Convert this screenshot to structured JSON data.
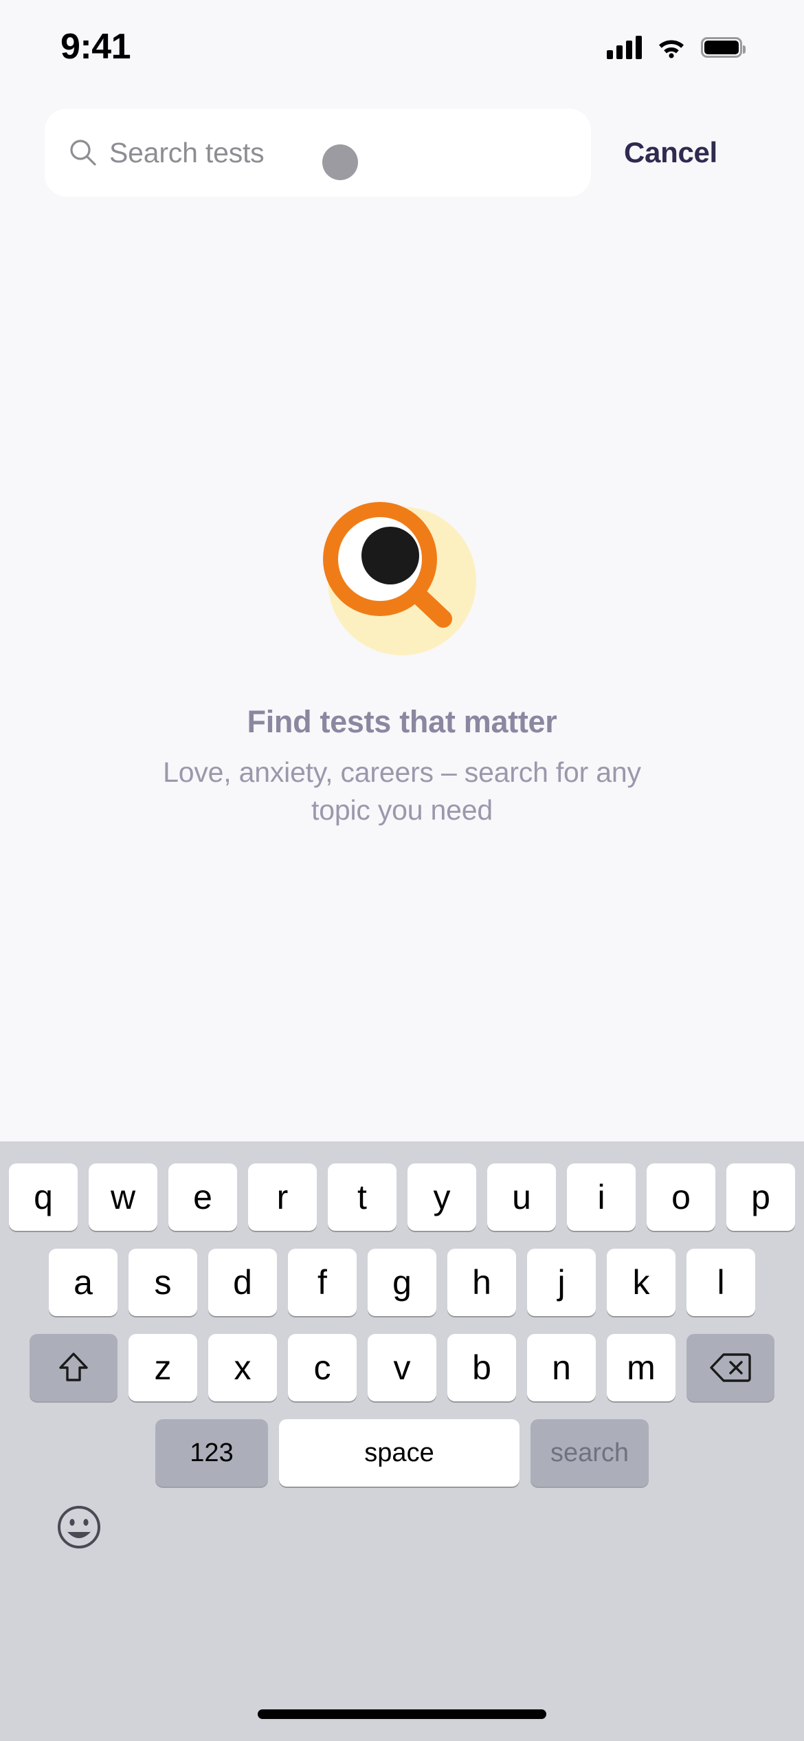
{
  "status_bar": {
    "time": "9:41",
    "signal_icon": "cellular-signal-icon",
    "wifi_icon": "wifi-icon",
    "battery_icon": "battery-full-icon"
  },
  "search": {
    "placeholder": "Search tests",
    "value": "",
    "search_icon": "search-icon",
    "cancel_label": "Cancel",
    "touch_indicator": "touch-indicator"
  },
  "empty_state": {
    "illustration": "magnifying-glass-eye-illustration",
    "title": "Find tests that matter",
    "subtitle": "Love, anxiety, careers – search for any topic you need"
  },
  "keyboard": {
    "row1": [
      "q",
      "w",
      "e",
      "r",
      "t",
      "y",
      "u",
      "i",
      "o",
      "p"
    ],
    "row2": [
      "a",
      "s",
      "d",
      "f",
      "g",
      "h",
      "j",
      "k",
      "l"
    ],
    "row3": [
      "z",
      "x",
      "c",
      "v",
      "b",
      "n",
      "m"
    ],
    "shift_icon": "shift-arrow-icon",
    "backspace_icon": "backspace-icon",
    "numbers_label": "123",
    "space_label": "space",
    "return_label": "search",
    "emoji_icon": "emoji-smiley-icon"
  },
  "colors": {
    "page_background": "#f8f7fa",
    "search_field_background": "#ffffff",
    "cancel_text": "#2e2b4f",
    "placeholder_text": "#8d8d93",
    "title_text": "#8a87a0",
    "subtitle_text": "#9a98ab",
    "illustration_circle": "#fdf0c0",
    "illustration_accent": "#f07c18",
    "illustration_pupil": "#1a1a1a",
    "keyboard_background": "#d1d3d9",
    "key_background": "#ffffff",
    "key_dark_background": "#acafba",
    "home_indicator": "#000000"
  }
}
